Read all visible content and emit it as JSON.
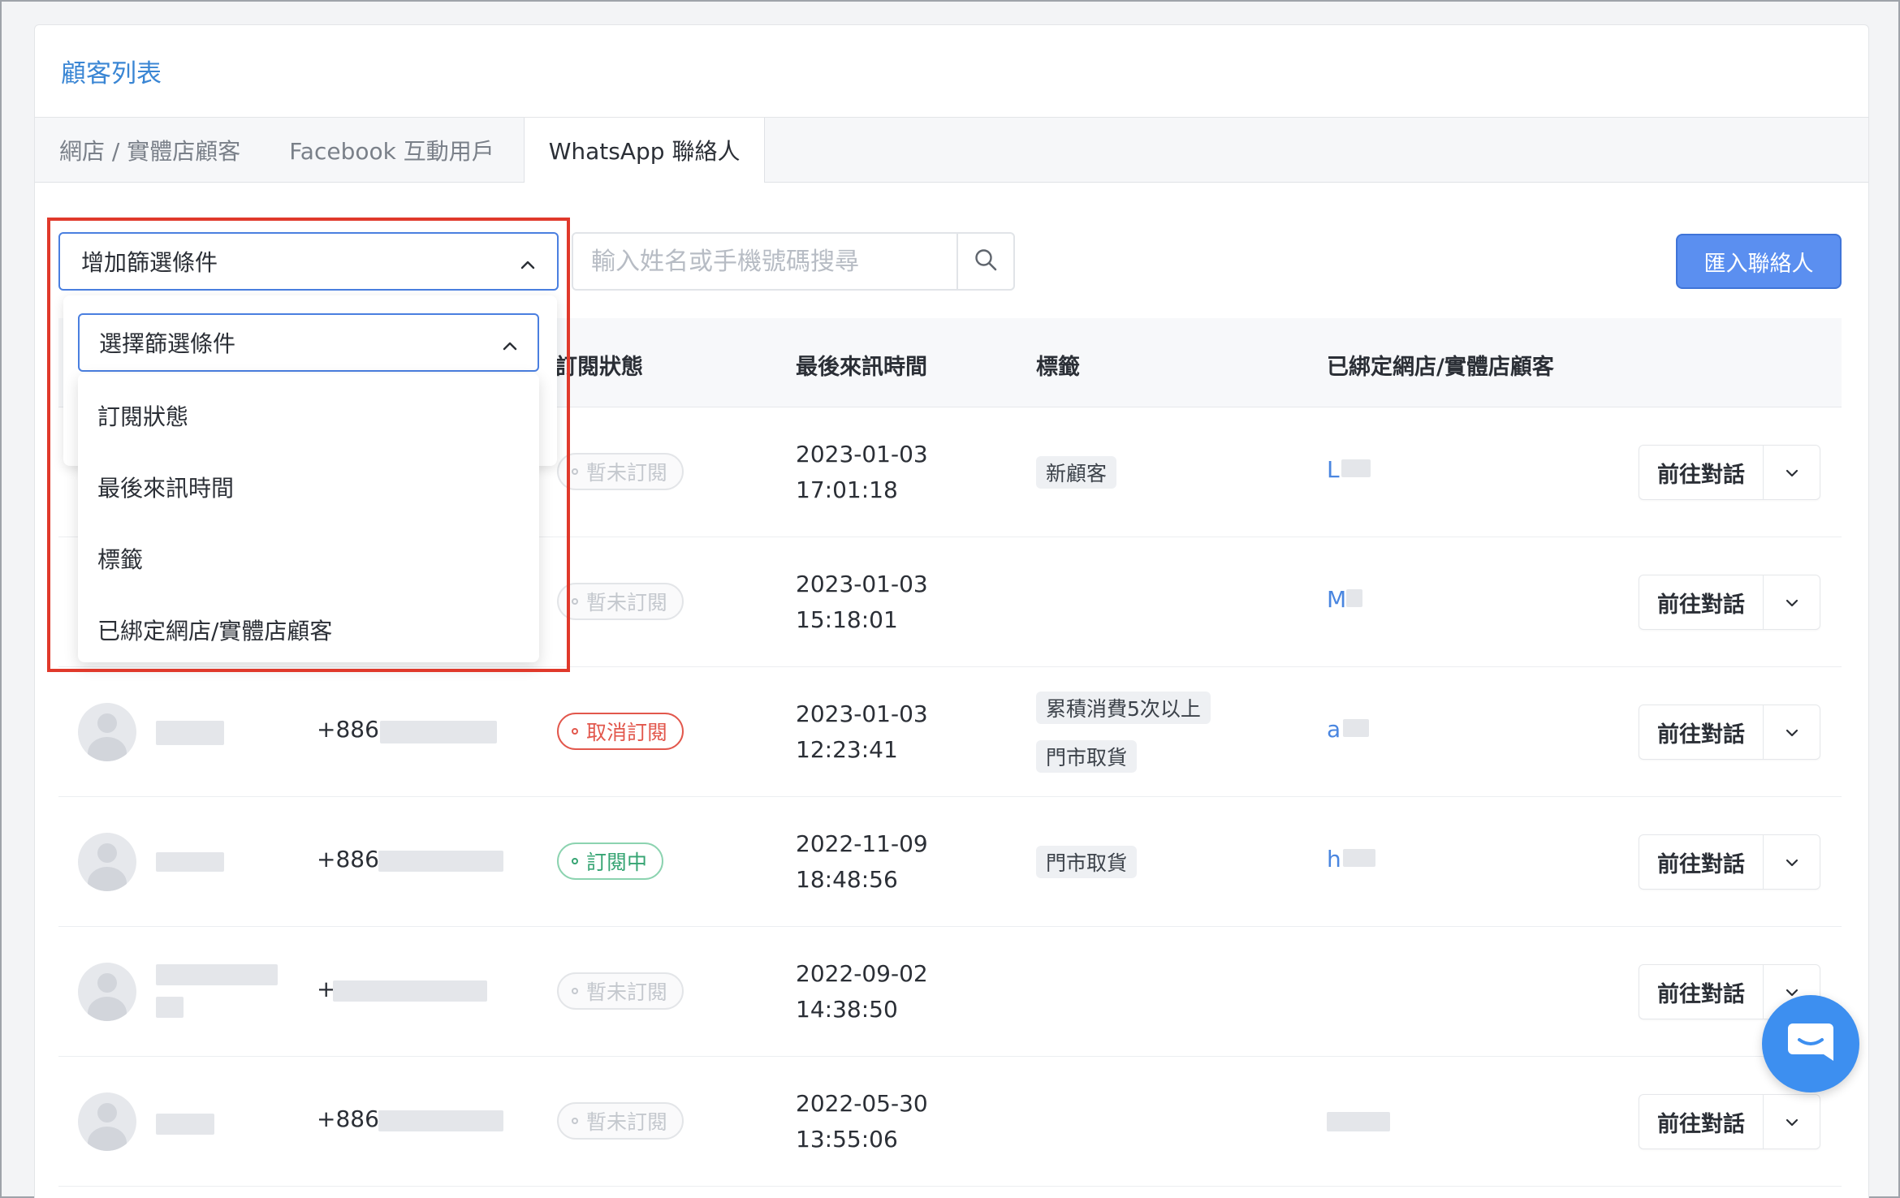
{
  "header": {
    "title": "顧客列表"
  },
  "tabs": [
    {
      "label": "網店 / 實體店顧客"
    },
    {
      "label": "Facebook 互動用戶"
    },
    {
      "label": "WhatsApp 聯絡人",
      "active": true
    }
  ],
  "toolbar": {
    "filter_label": "增加篩選條件",
    "search_placeholder": "輸入姓名或手機號碼搜尋",
    "import_label": "匯入聯絡人"
  },
  "filter_dropdown": {
    "select_label": "選擇篩選條件",
    "options": [
      "訂閱狀態",
      "最後來訊時間",
      "標籤",
      "已綁定網店/實體店顧客"
    ]
  },
  "table": {
    "columns": {
      "status": "訂閱狀態",
      "last_message": "最後來訊時間",
      "tags": "標籤",
      "bound": "已綁定網店/實體店顧客"
    },
    "action_label": "前往對話",
    "rows": [
      {
        "phone": "",
        "status": "暫未訂閱",
        "status_type": "muted",
        "date": "2023-01-03",
        "time": "17:01:18",
        "tags": [
          "新顧客"
        ],
        "bound": "L"
      },
      {
        "phone": "",
        "status": "暫未訂閱",
        "status_type": "muted",
        "date": "2023-01-03",
        "time": "15:18:01",
        "tags": [],
        "bound": "M"
      },
      {
        "phone": "+886",
        "status": "取消訂閱",
        "status_type": "red",
        "date": "2023-01-03",
        "time": "12:23:41",
        "tags": [
          "累積消費5次以上",
          "門市取貨"
        ],
        "bound": "a"
      },
      {
        "phone": "+886",
        "status": "訂閱中",
        "status_type": "green",
        "date": "2022-11-09",
        "time": "18:48:56",
        "tags": [
          "門市取貨"
        ],
        "bound": "h"
      },
      {
        "phone": "+",
        "status": "暫未訂閱",
        "status_type": "muted",
        "date": "2022-09-02",
        "time": "14:38:50",
        "tags": [],
        "bound": ""
      },
      {
        "phone": "+886",
        "status": "暫未訂閱",
        "status_type": "muted",
        "date": "2022-05-30",
        "time": "13:55:06",
        "tags": [],
        "bound": ""
      }
    ]
  },
  "colors": {
    "accent": "#4a7fe0",
    "import_button": "#5b8ff0",
    "highlight": "#e0392b",
    "unsubscribed": "#e2574c",
    "subscribed": "#36a473",
    "chat_fab": "#3d8ff0"
  }
}
